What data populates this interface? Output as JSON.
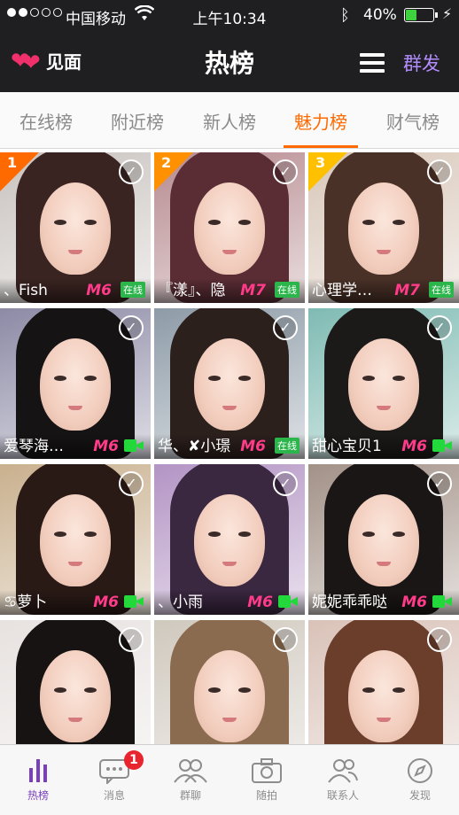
{
  "status_bar": {
    "carrier": "中国移动",
    "time": "上午10:34",
    "battery_percent": "40%",
    "battery_level": 0.4
  },
  "nav": {
    "logo_text": "见面",
    "title": "热榜",
    "group_send": "群发"
  },
  "tabs": [
    {
      "label": "在线榜"
    },
    {
      "label": "附近榜"
    },
    {
      "label": "新人榜"
    },
    {
      "label": "魅力榜",
      "active": true
    },
    {
      "label": "财气榜"
    }
  ],
  "colors": {
    "accent": "#ff6a00",
    "rank1": "#ff6a00",
    "rank2": "#ff9000",
    "rank3": "#ffc000",
    "active_tab_bottom": "#7b3fbd"
  },
  "users": [
    {
      "rank": "1",
      "name": "、Fish",
      "level": "M6",
      "status": "在线",
      "hair": "#3a2421",
      "bg": "#c9c3bf"
    },
    {
      "rank": "2",
      "name": "『漾』、隐",
      "level": "M7",
      "status": "在线",
      "hair": "#5a2d34",
      "bg": "#b68a8f"
    },
    {
      "rank": "3",
      "name": "心理学…",
      "level": "M7",
      "status": "在线",
      "hair": "#4a3127",
      "bg": "#d8c7b9"
    },
    {
      "name": "爱琴海…",
      "level": "M6",
      "status": "video",
      "hair": "#151313",
      "bg": "#8c8aa5"
    },
    {
      "name": "华、✘小璟",
      "level": "M6",
      "status": "在线",
      "hair": "#2c201d",
      "bg": "#8d9ba7"
    },
    {
      "name": "甜心宝贝1",
      "level": "M6",
      "status": "video",
      "hair": "#1c1a19",
      "bg": "#7fbbb3"
    },
    {
      "name": "♋萝卜",
      "level": "M6",
      "status": "video",
      "hair": "#2a1a16",
      "bg": "#c9b08e"
    },
    {
      "name": "、小雨",
      "level": "M6",
      "status": "video",
      "hair": "#3a2740",
      "bg": "#b394c4"
    },
    {
      "name": "妮妮乖乖哒",
      "level": "M6",
      "status": "video",
      "hair": "#1b1616",
      "bg": "#a29187"
    },
    {
      "name": "",
      "level": "",
      "status": "",
      "hair": "#161312",
      "bg": "#e7e2e0"
    },
    {
      "name": "",
      "level": "",
      "status": "",
      "hair": "#8a6b4f",
      "bg": "#cfc8bd"
    },
    {
      "name": "",
      "level": "",
      "status": "",
      "hair": "#6b3e2c",
      "bg": "#d9c2b8"
    }
  ],
  "bottom_nav": [
    {
      "label": "热榜",
      "icon": "chart-bars-icon",
      "active": true
    },
    {
      "label": "消息",
      "icon": "chat-bubble-icon",
      "badge": "1"
    },
    {
      "label": "群聊",
      "icon": "group-people-icon"
    },
    {
      "label": "随拍",
      "icon": "camera-icon"
    },
    {
      "label": "联系人",
      "icon": "contacts-icon"
    },
    {
      "label": "发现",
      "icon": "compass-icon"
    }
  ]
}
